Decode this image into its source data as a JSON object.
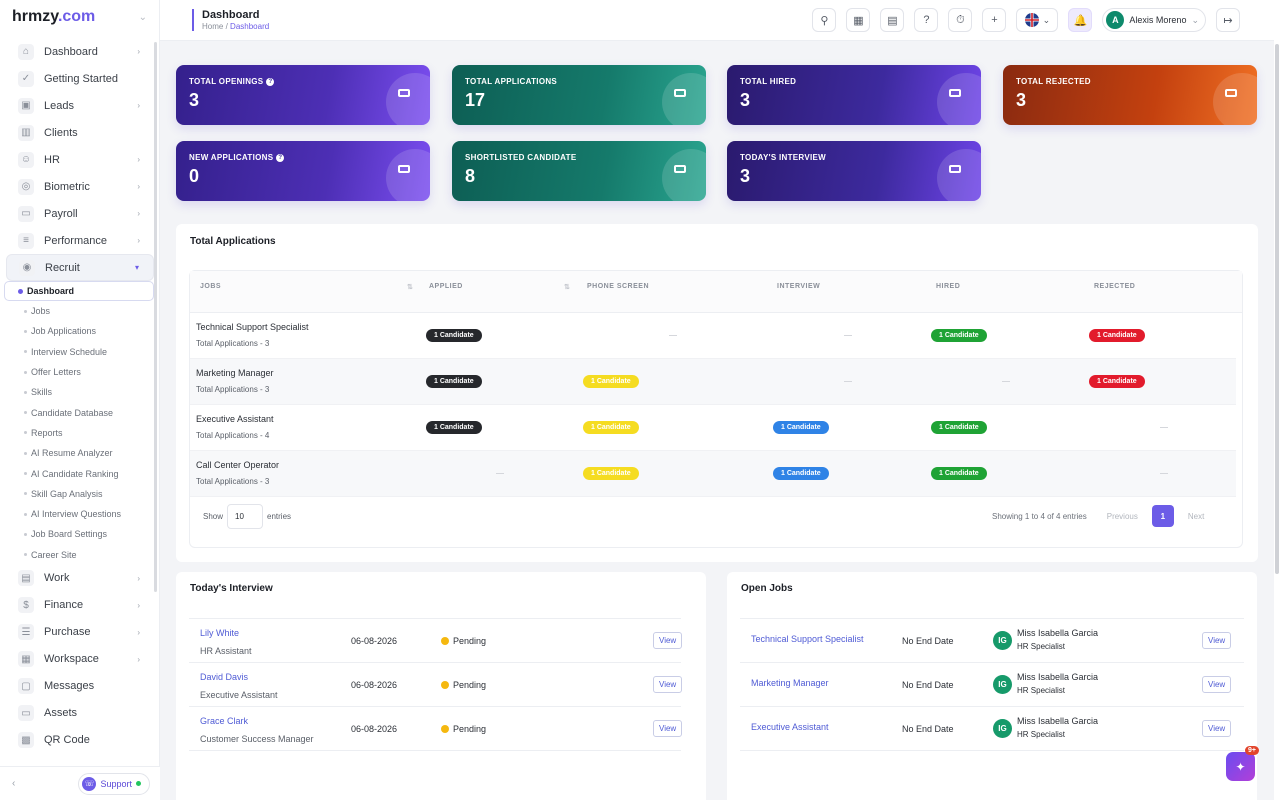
{
  "brand": {
    "name": "hrmzy",
    "tld": ".com"
  },
  "sidebar": {
    "items_top": [
      {
        "label": "Dashboard",
        "icon": "home-icon",
        "arrow": true
      },
      {
        "label": "Getting Started",
        "icon": "check-circle-icon",
        "arrow": false
      },
      {
        "label": "Leads",
        "icon": "contact-card-icon",
        "arrow": true
      },
      {
        "label": "Clients",
        "icon": "building-icon",
        "arrow": false
      },
      {
        "label": "HR",
        "icon": "people-icon",
        "arrow": true
      },
      {
        "label": "Biometric",
        "icon": "fingerprint-icon",
        "arrow": true
      },
      {
        "label": "Payroll",
        "icon": "wallet-icon",
        "arrow": true
      },
      {
        "label": "Performance",
        "icon": "bar-chart-icon",
        "arrow": true
      },
      {
        "label": "Recruit",
        "icon": "recruit-icon",
        "arrow": true,
        "active": true
      }
    ],
    "recruit_sub": [
      "Dashboard",
      "Jobs",
      "Job Applications",
      "Interview Schedule",
      "Offer Letters",
      "Skills",
      "Candidate Database",
      "Reports",
      "AI Resume Analyzer",
      "AI Candidate Ranking",
      "Skill Gap Analysis",
      "AI Interview Questions",
      "Job Board Settings",
      "Career Site"
    ],
    "items_bottom": [
      {
        "label": "Work",
        "icon": "briefcase-icon",
        "arrow": true
      },
      {
        "label": "Finance",
        "icon": "dollar-icon",
        "arrow": true
      },
      {
        "label": "Purchase",
        "icon": "layers-icon",
        "arrow": true
      },
      {
        "label": "Workspace",
        "icon": "grid-icon",
        "arrow": true
      },
      {
        "label": "Messages",
        "icon": "message-icon",
        "arrow": false
      },
      {
        "label": "Assets",
        "icon": "monitor-icon",
        "arrow": false
      },
      {
        "label": "QR Code",
        "icon": "qr-code-icon",
        "arrow": false
      }
    ],
    "support_label": "Support"
  },
  "header": {
    "title": "Dashboard",
    "breadcrumb_home": "Home",
    "breadcrumb_sep": "/",
    "breadcrumb_current": "Dashboard",
    "user_initial": "A",
    "user_name": "Alexis Moreno",
    "notification_count": "0"
  },
  "stats": [
    {
      "label": "TOTAL OPENINGS",
      "value": "3",
      "help": true,
      "theme": "purple"
    },
    {
      "label": "TOTAL APPLICATIONS",
      "value": "17",
      "help": false,
      "theme": "teal"
    },
    {
      "label": "TOTAL HIRED",
      "value": "3",
      "help": false,
      "theme": "violet"
    },
    {
      "label": "TOTAL REJECTED",
      "value": "3",
      "help": false,
      "theme": "orange"
    },
    {
      "label": "NEW APPLICATIONS",
      "value": "0",
      "help": true,
      "theme": "purple"
    },
    {
      "label": "SHORTLISTED CANDIDATE",
      "value": "8",
      "help": false,
      "theme": "teal"
    },
    {
      "label": "TODAY'S INTERVIEW",
      "value": "3",
      "help": false,
      "theme": "violet"
    }
  ],
  "applications": {
    "title": "Total Applications",
    "columns": [
      "JOBS",
      "APPLIED",
      "PHONE SCREEN",
      "INTERVIEW",
      "HIRED",
      "REJECTED"
    ],
    "rows": [
      {
        "job": "Technical Support Specialist",
        "sub": "Total Applications - 3",
        "cells": [
          "1 Candidate",
          "",
          "",
          "1 Candidate",
          "1 Candidate"
        ]
      },
      {
        "job": "Marketing Manager",
        "sub": "Total Applications - 3",
        "cells": [
          "1 Candidate",
          "1 Candidate",
          "",
          "",
          "1 Candidate"
        ]
      },
      {
        "job": "Executive Assistant",
        "sub": "Total Applications - 4",
        "cells": [
          "1 Candidate",
          "1 Candidate",
          "1 Candidate",
          "1 Candidate",
          ""
        ]
      },
      {
        "job": "Call Center Operator",
        "sub": "Total Applications - 3",
        "cells": [
          "",
          "1 Candidate",
          "1 Candidate",
          "1 Candidate",
          ""
        ]
      }
    ],
    "show_label": "Show",
    "entries_value": "10",
    "entries_label": "entries",
    "showing_text": "Showing 1 to 4 of 4 entries",
    "prev_label": "Previous",
    "page": "1",
    "next_label": "Next"
  },
  "todays_interview": {
    "title": "Today's Interview",
    "rows": [
      {
        "name": "Lily White",
        "role": "HR Assistant",
        "date": "06-08-2026",
        "status": "Pending",
        "action": "View"
      },
      {
        "name": "David Davis",
        "role": "Executive Assistant",
        "date": "06-08-2026",
        "status": "Pending",
        "action": "View"
      },
      {
        "name": "Grace Clark",
        "role": "Customer Success Manager",
        "date": "06-08-2026",
        "status": "Pending",
        "action": "View"
      }
    ]
  },
  "open_jobs": {
    "title": "Open Jobs",
    "rows": [
      {
        "job": "Technical Support Specialist",
        "end": "No End Date",
        "initials": "IG",
        "person": "Miss Isabella Garcia",
        "role": "HR Specialist",
        "action": "View"
      },
      {
        "job": "Marketing Manager",
        "end": "No End Date",
        "initials": "IG",
        "person": "Miss Isabella Garcia",
        "role": "HR Specialist",
        "action": "View"
      },
      {
        "job": "Executive Assistant",
        "end": "No End Date",
        "initials": "IG",
        "person": "Miss Isabella Garcia",
        "role": "HR Specialist",
        "action": "View"
      }
    ]
  },
  "ai_fab": {
    "badge": "9+"
  },
  "colors": {
    "accent": "#6c5ce7",
    "badge_applied": "#26282c",
    "badge_phone": "#f5dc21",
    "badge_interview": "#2f83e6",
    "badge_hired": "#1fa335",
    "badge_rejected": "#e21b2c"
  }
}
